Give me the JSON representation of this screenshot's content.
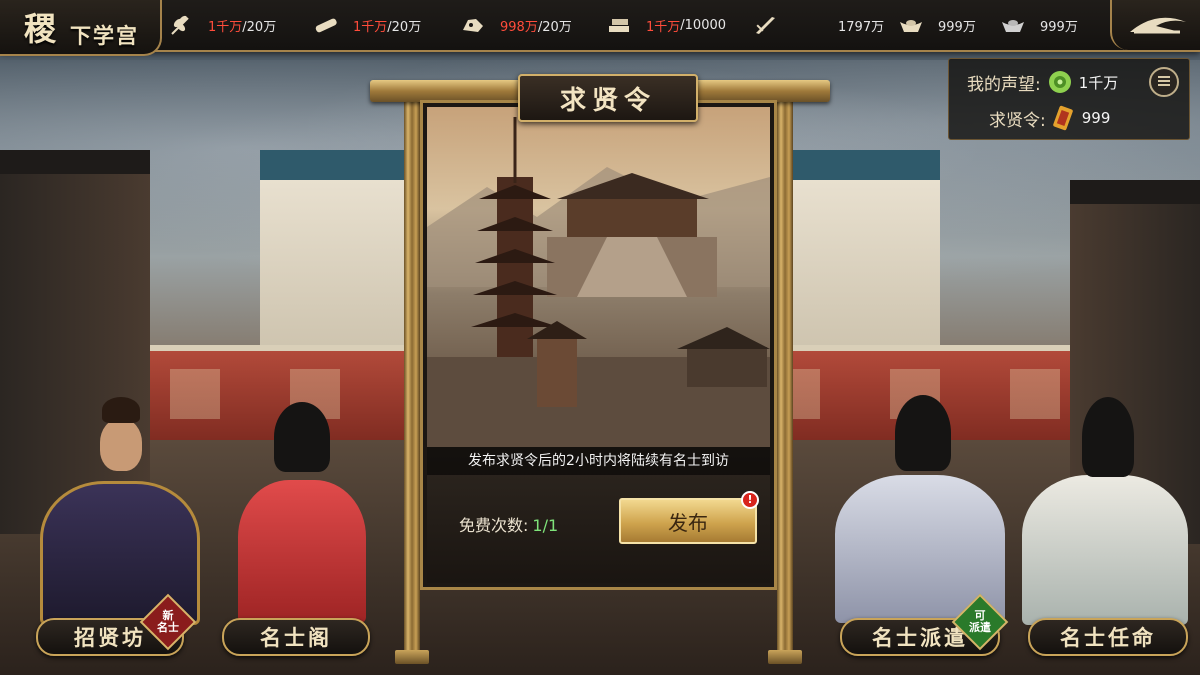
{
  "header": {
    "title_big": "稷",
    "title_small": "下学宫",
    "resources": [
      {
        "icon": "wheat-icon",
        "current": "1千万",
        "max": "/20万",
        "current_color": "red"
      },
      {
        "icon": "timber-icon",
        "current": "1千万",
        "max": "/20万",
        "current_color": "red"
      },
      {
        "icon": "ore-icon",
        "current": "998万",
        "max": "/20万",
        "current_color": "red"
      },
      {
        "icon": "stone-icon",
        "current": "1千万",
        "max": "/10000",
        "current_color": "red"
      },
      {
        "icon": "sword-icon",
        "current": "",
        "max": "1797万",
        "current_color": "white"
      },
      {
        "icon": "gold-ingot-icon",
        "current": "",
        "max": "999万",
        "current_color": "white"
      },
      {
        "icon": "silver-ingot-icon",
        "current": "",
        "max": "999万",
        "current_color": "white"
      }
    ]
  },
  "info": {
    "prestige_label": "我的声望:",
    "prestige_value": "1千万",
    "token_label": "求贤令:",
    "token_value": "999"
  },
  "board": {
    "title": "求贤令",
    "notice": "发布求贤令后的2小时内将陆续有名士到访",
    "free_label": "免费次数:",
    "free_count": "1/1",
    "publish_label": "发布",
    "alert_mark": "!"
  },
  "nav": {
    "recruit": "招贤坊",
    "scholars": "名士阁",
    "dispatch": "名士派遣",
    "appoint": "名士任命"
  },
  "badges": {
    "new_top": "新",
    "new_bottom": "名士",
    "can_top": "可",
    "can_bottom": "派遣"
  },
  "colors": {
    "gold": "#c9a459",
    "alert_red": "#d8241c",
    "count_green": "#7fe37a",
    "resource_red": "#ff4c3b"
  }
}
